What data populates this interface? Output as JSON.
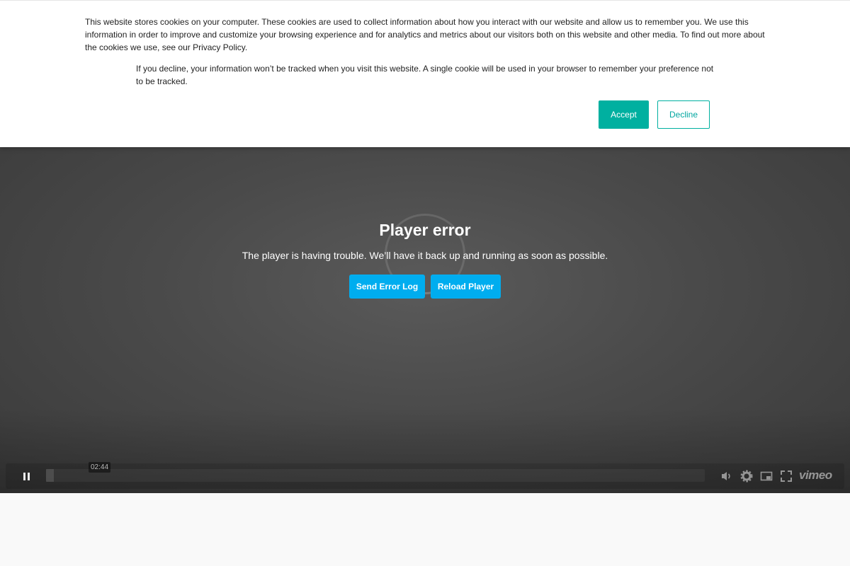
{
  "cookie_banner": {
    "text_main": "This website stores cookies on your computer. These cookies are used to collect information about how you interact with our website and allow us to remember you. We use this information in order to improve and customize your browsing experience and for analytics and metrics about our visitors both on this website and other media. To find out more about the cookies we use, see our Privacy Policy.",
    "text_decline": "If you decline, your information won’t be tracked when you visit this website. A single cookie will be used in your browser to remember your preference not to be tracked.",
    "accept_label": "Accept",
    "decline_label": "Decline",
    "accent_color": "#00b0a0"
  },
  "player": {
    "error_title": "Player error",
    "error_message": "The player is having trouble. We’ll have it back up and running as soon as possible.",
    "send_log_label": "Send Error Log",
    "reload_label": "Reload Player",
    "button_color": "#00adef",
    "controls": {
      "time_tooltip": "02:44",
      "progress_fraction": 0.012,
      "icons": [
        "pause-icon",
        "volume-icon",
        "settings-gear-icon",
        "picture-in-picture-icon",
        "fullscreen-icon",
        "vimeo-logo"
      ],
      "brand": "vimeo"
    }
  }
}
